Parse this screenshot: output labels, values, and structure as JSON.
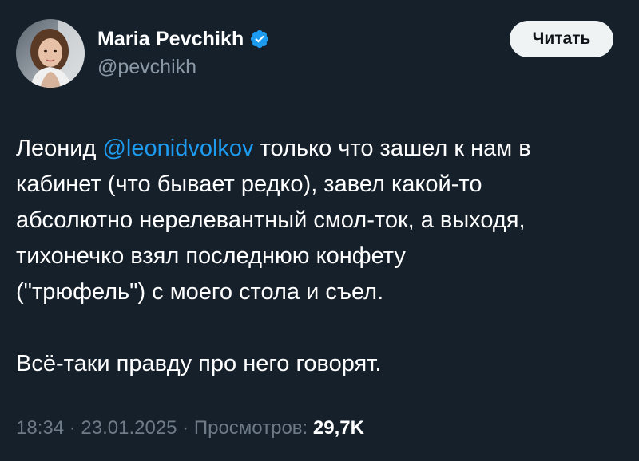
{
  "author": {
    "name": "Maria Pevchikh",
    "handle": "@pevchikh",
    "verified_color": "#1d9bf0"
  },
  "follow_button": {
    "label": "Читать"
  },
  "tweet": {
    "line1_before": "Леонид ",
    "mention": "@leonidvolkov",
    "line1_after": "  только что зашел к нам в",
    "line2": "кабинет (что бывает редко), завел какой-то",
    "line3": "абсолютно нерелевантный смол-ток, а выходя,",
    "line4": "тихонечко взял последнюю конфету",
    "line5": "(\"трюфель\") с моего стола и съел.",
    "line6": "Всё-таки правду про него говорят."
  },
  "meta": {
    "time": "18:34",
    "date": "23.01.2025",
    "views_label": "Просмотров:",
    "views_count": "29,7K",
    "separator": " · "
  },
  "colors": {
    "background": "#15202b",
    "link": "#1d9bf0",
    "secondary_text": "#8b98a5"
  }
}
